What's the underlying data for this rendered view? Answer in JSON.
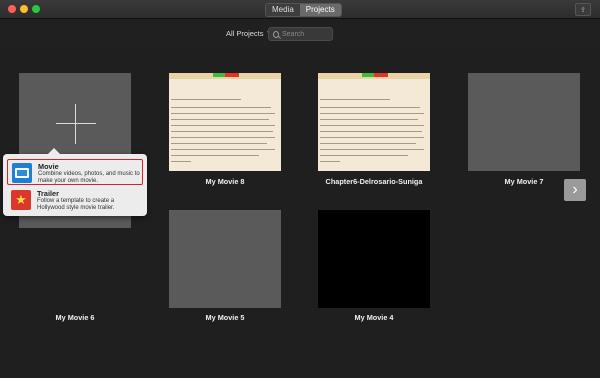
{
  "toolbar": {
    "tabs": [
      {
        "label": "Media"
      },
      {
        "label": "Projects"
      }
    ],
    "filter_label": "All Projects",
    "search_placeholder": "Search"
  },
  "projects": [
    {
      "name": "My Movie 8"
    },
    {
      "name": "Chapter6-Delrosario-Suniga"
    },
    {
      "name": "My Movie 7"
    },
    {
      "name": "My Movie 6"
    },
    {
      "name": "My Movie 5"
    },
    {
      "name": "My Movie 4"
    }
  ],
  "new_menu": {
    "movie": {
      "title": "Movie",
      "description": "Combine videos, photos, and music to make your own movie."
    },
    "trailer": {
      "title": "Trailer",
      "description": "Follow a template to create a Hollywood style movie trailer."
    }
  },
  "colors": {
    "highlight": "#d0252b",
    "movie_icon": "#1e7fd6",
    "trailer_icon": "#d9392a"
  },
  "icons": [
    "search-icon",
    "share-icon",
    "plus-icon",
    "movie-icon",
    "trailer-icon",
    "chevron-right-icon"
  ]
}
